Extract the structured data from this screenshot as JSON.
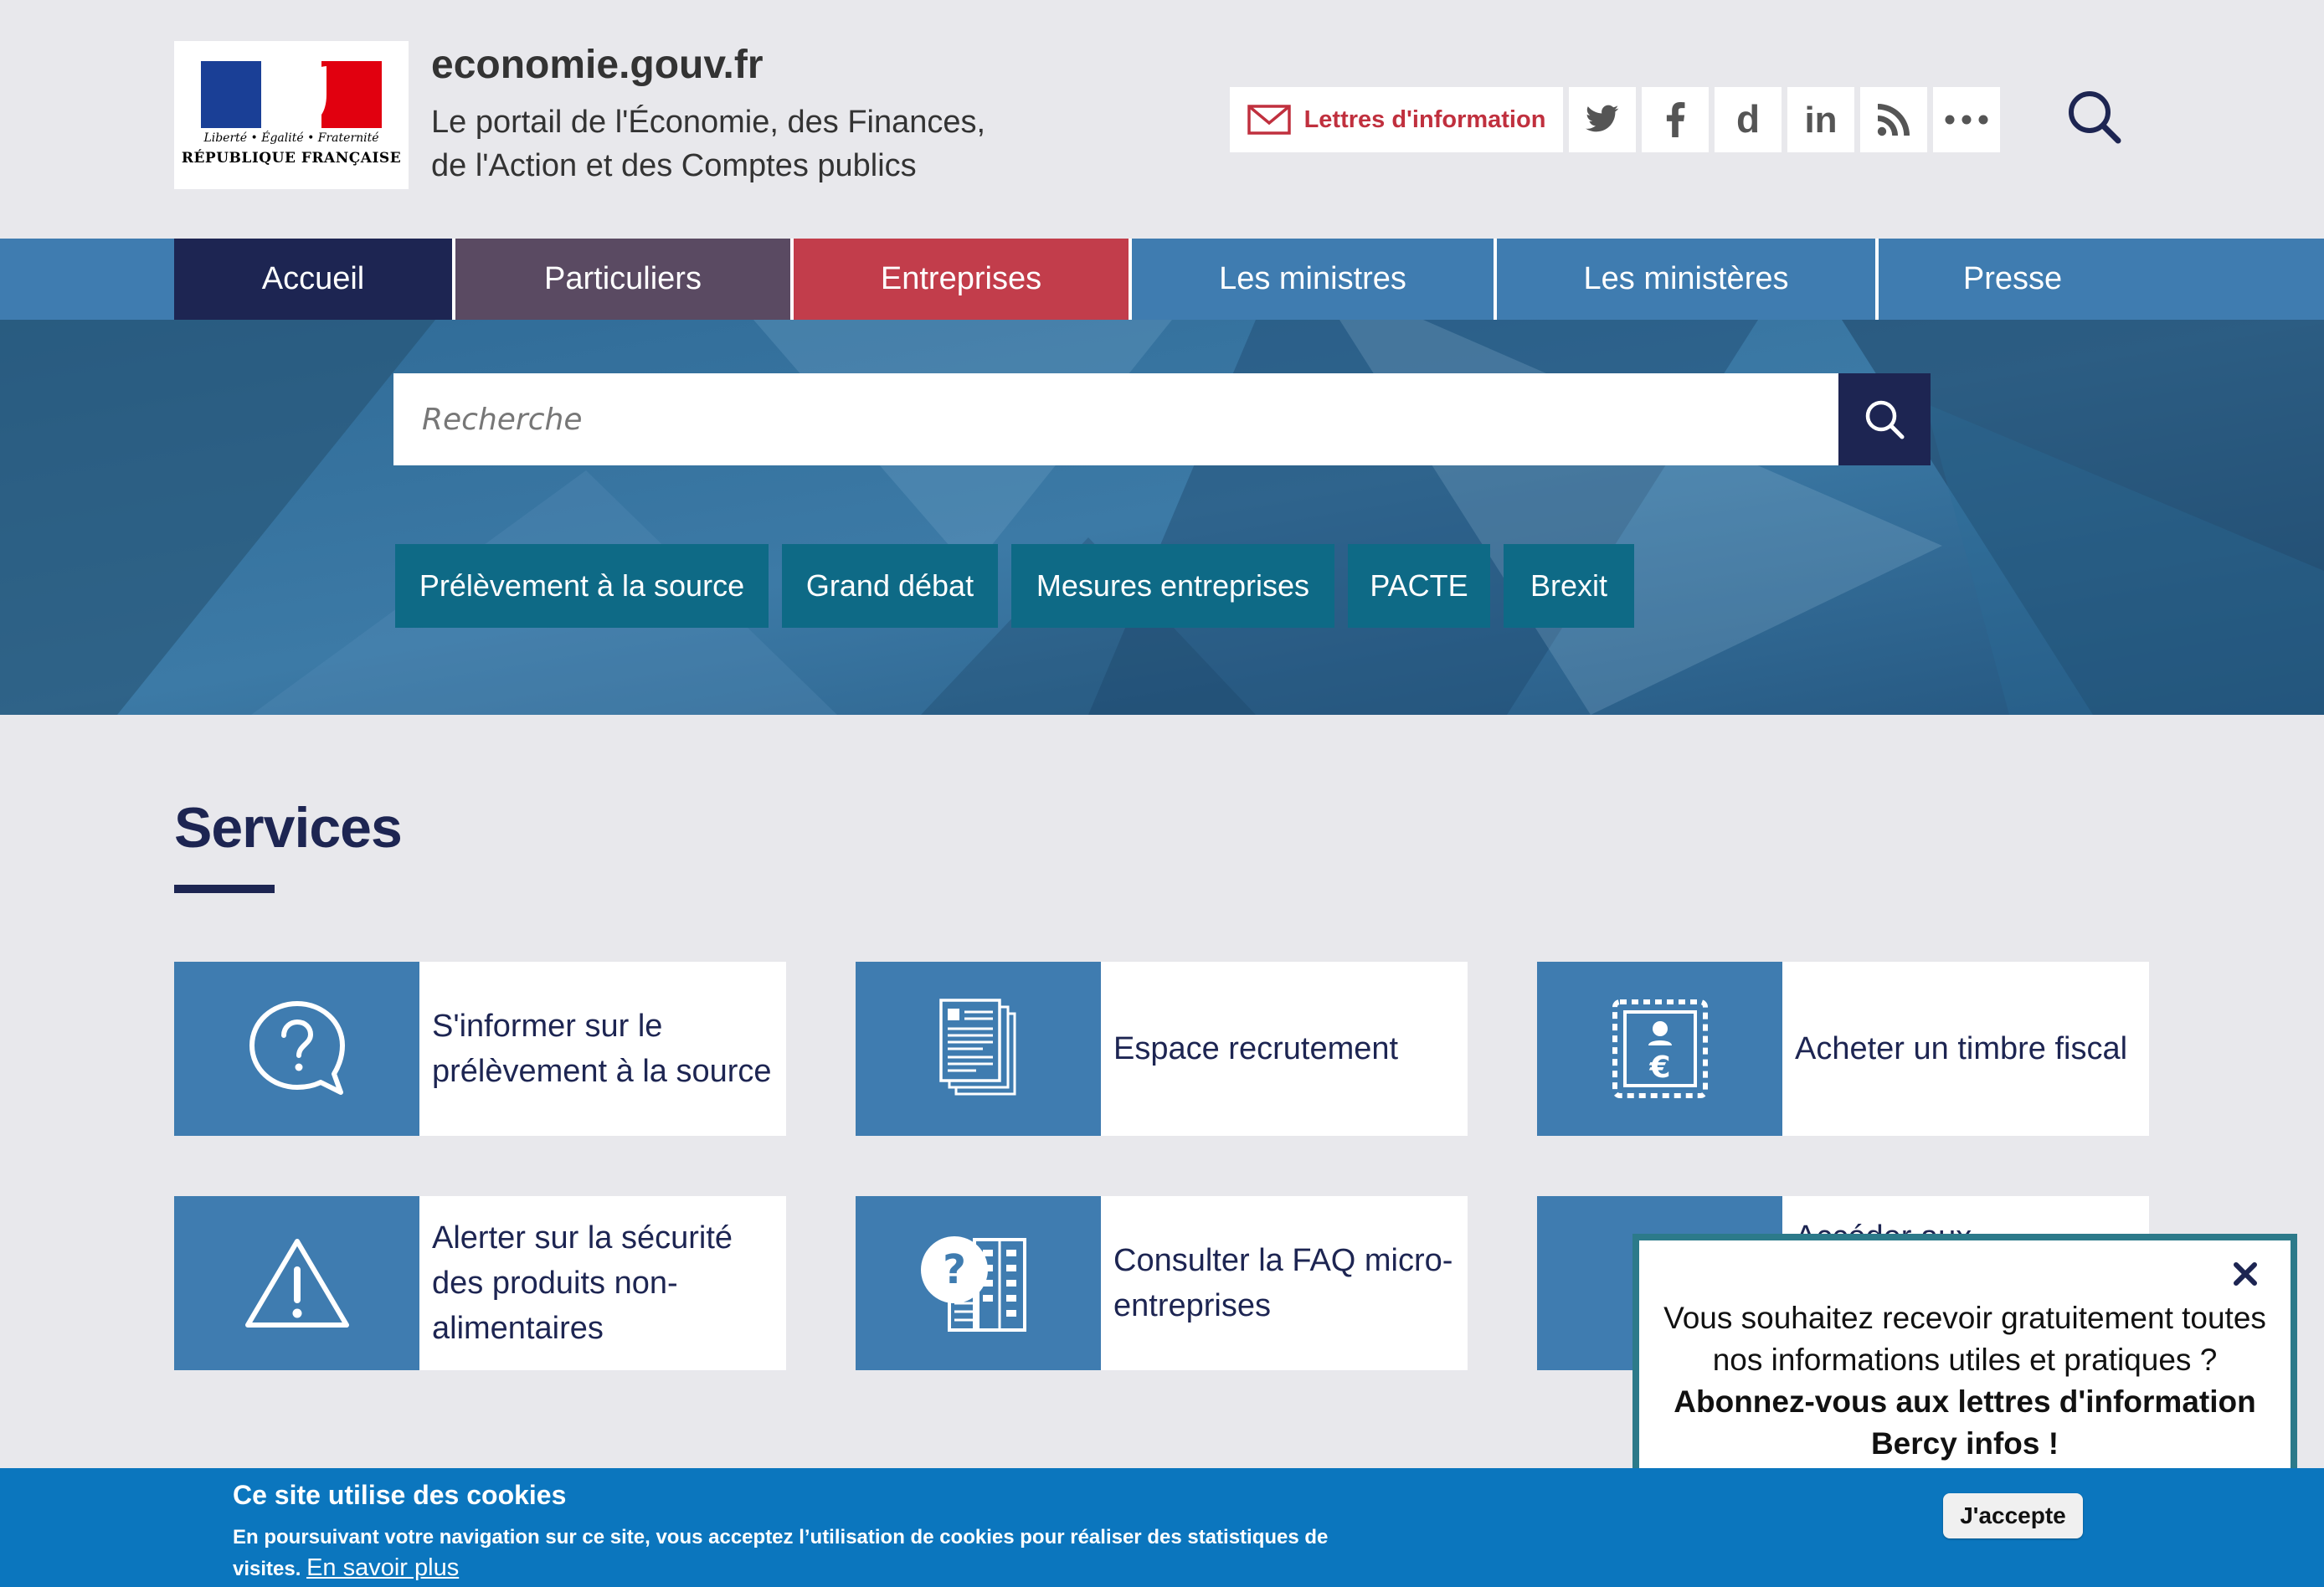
{
  "header": {
    "logo": {
      "motto": "Liberté • Égalité • Fraternité",
      "republic": "RÉPUBLIQUE FRANÇAISE"
    },
    "site_name": "economie.gouv.fr",
    "tagline_line1": "Le portail de l'Économie, des Finances,",
    "tagline_line2": "de l'Action et des Comptes publics",
    "newsletter_label": "Lettres d'information",
    "social_icons": [
      "twitter-icon",
      "facebook-icon",
      "dailymotion-icon",
      "linkedin-icon",
      "rss-icon",
      "more-icon"
    ],
    "search_icon": "search-icon"
  },
  "nav": {
    "items": [
      {
        "label": "Accueil",
        "color": "#1d2552"
      },
      {
        "label": "Particuliers",
        "color": "#5a4a62"
      },
      {
        "label": "Entreprises",
        "color": "#c23d4b"
      },
      {
        "label": "Les ministres",
        "color": "#3f7cb0"
      },
      {
        "label": "Les ministères",
        "color": "#3f7cb0"
      },
      {
        "label": "Presse",
        "color": "#3f7cb0"
      }
    ]
  },
  "hero": {
    "search_placeholder": "Recherche",
    "quick_links": [
      "Prélèvement à la source",
      "Grand débat",
      "Mesures entreprises",
      "PACTE",
      "Brexit"
    ]
  },
  "services": {
    "title": "Services",
    "cards": [
      {
        "label": "S'informer sur le prélèvement à la source",
        "icon": "question-bubble-icon"
      },
      {
        "label": "Espace recrutement",
        "icon": "documents-icon"
      },
      {
        "label": "Acheter un timbre fiscal",
        "icon": "euro-stamp-icon"
      },
      {
        "label": "Alerter sur la sécurité des produits non-alimentaires",
        "icon": "warning-icon"
      },
      {
        "label": "Consulter la FAQ micro-entreprises",
        "icon": "faq-building-icon"
      },
      {
        "label": "Accéder aux",
        "icon": "service-icon"
      }
    ]
  },
  "popup": {
    "line1": "Vous souhaitez recevoir gratuitement toutes nos informations utiles et pratiques ?",
    "line2": "Abonnez-vous aux lettres d'information Bercy infos !"
  },
  "cookie": {
    "title": "Ce site utilise des cookies",
    "body": "En poursuivant votre navigation sur ce site, vous acceptez l’utilisation de cookies pour réaliser des statistiques de visites.",
    "link": "En savoir plus",
    "accept": "J'accepte"
  },
  "colors": {
    "navy": "#1d2552",
    "steel_blue": "#3f7cb0",
    "teal": "#0e6a86",
    "red": "#c0303e",
    "cookie_blue": "#0b76be"
  }
}
